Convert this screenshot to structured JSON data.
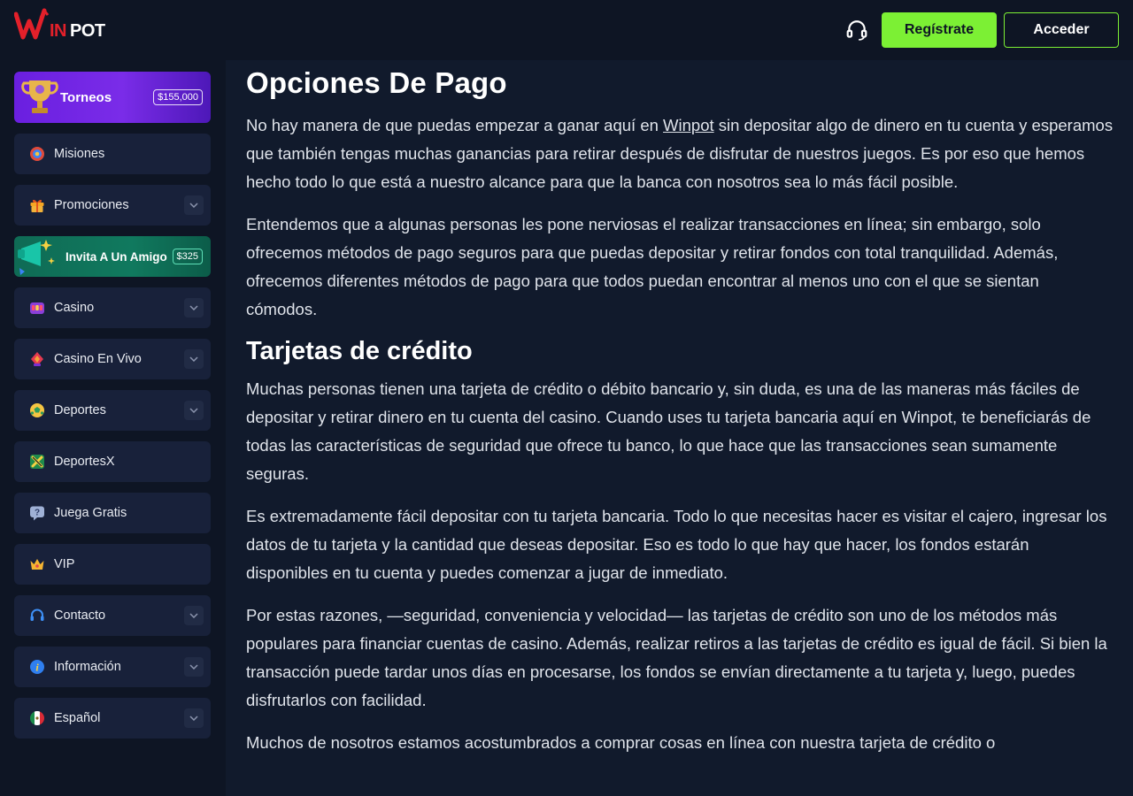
{
  "header": {
    "logo_text": "WINPOT",
    "register_label": "Regístrate",
    "login_label": "Acceder",
    "colors": {
      "accent": "#7cf034",
      "logo_red": "#e3202a",
      "background": "#0e1524"
    }
  },
  "sidebar": {
    "items": [
      {
        "label": "Torneos",
        "badge": "$155,000",
        "icon": "trophy-icon"
      },
      {
        "label": "Misiones",
        "icon": "target-icon"
      },
      {
        "label": "Promociones",
        "icon": "gift-icon"
      },
      {
        "label": "Invita A Un Amigo",
        "badge": "$325",
        "icon": "megaphone-icon"
      },
      {
        "label": "Casino",
        "icon": "slot-machine-icon"
      },
      {
        "label": "Casino En Vivo",
        "icon": "poker-chip-icon"
      },
      {
        "label": "Deportes",
        "icon": "soccer-ball-icon"
      },
      {
        "label": "DeportesX",
        "icon": "x-sports-icon"
      },
      {
        "label": "Juega Gratis",
        "icon": "question-bubble-icon"
      },
      {
        "label": "VIP",
        "icon": "crown-icon"
      },
      {
        "label": "Contacto",
        "icon": "headset-icon"
      },
      {
        "label": "Información",
        "icon": "info-icon"
      },
      {
        "label": "Español",
        "icon": "mexico-flag-icon"
      }
    ]
  },
  "main": {
    "title": "Opciones De Pago",
    "p1_before": "No hay manera de que puedas empezar a ganar aquí en ",
    "p1_link": "Winpot",
    "p1_after": " sin depositar algo de dinero en tu cuenta y esperamos que también tengas muchas ganancias para retirar después de disfrutar de nuestros juegos. Es por eso que hemos hecho todo lo que está a nuestro alcance para que la banca con nosotros sea lo más fácil posible.",
    "p2": "Entendemos que a algunas personas les pone nerviosas el realizar transacciones en línea; sin embargo, solo ofrecemos métodos de pago seguros para que puedas depositar y retirar fondos con total tranquilidad. Además, ofrecemos diferentes métodos de pago para que todos puedan encontrar al menos uno con el que se sientan cómodos.",
    "subtitle": "Tarjetas de crédito",
    "p3": "Muchas personas tienen una tarjeta de crédito o débito bancario y, sin duda, es una de las maneras más fáciles de depositar y retirar dinero en tu cuenta del casino. Cuando uses tu tarjeta bancaria aquí en Winpot, te beneficiarás de todas las características de seguridad que ofrece tu banco, lo que hace que las transacciones sean sumamente seguras.",
    "p4": "Es extremadamente fácil depositar con tu tarjeta bancaria. Todo lo que necesitas hacer es visitar el cajero, ingresar los datos de tu tarjeta y la cantidad que deseas depositar. Eso es todo lo que hay que hacer, los fondos estarán disponibles en tu cuenta y puedes comenzar a jugar de inmediato.",
    "p5": "Por estas razones, —seguridad, conveniencia y velocidad— las tarjetas de crédito son uno de los métodos más populares para financiar cuentas de casino. Además, realizar retiros a las tarjetas de crédito es igual de fácil. Si bien la transacción puede tardar unos días en procesarse, los fondos se envían directamente a tu tarjeta y, luego, puedes disfrutarlos con facilidad.",
    "p6": "Muchos de nosotros estamos acostumbrados a comprar cosas en línea con nuestra tarjeta de crédito o"
  }
}
